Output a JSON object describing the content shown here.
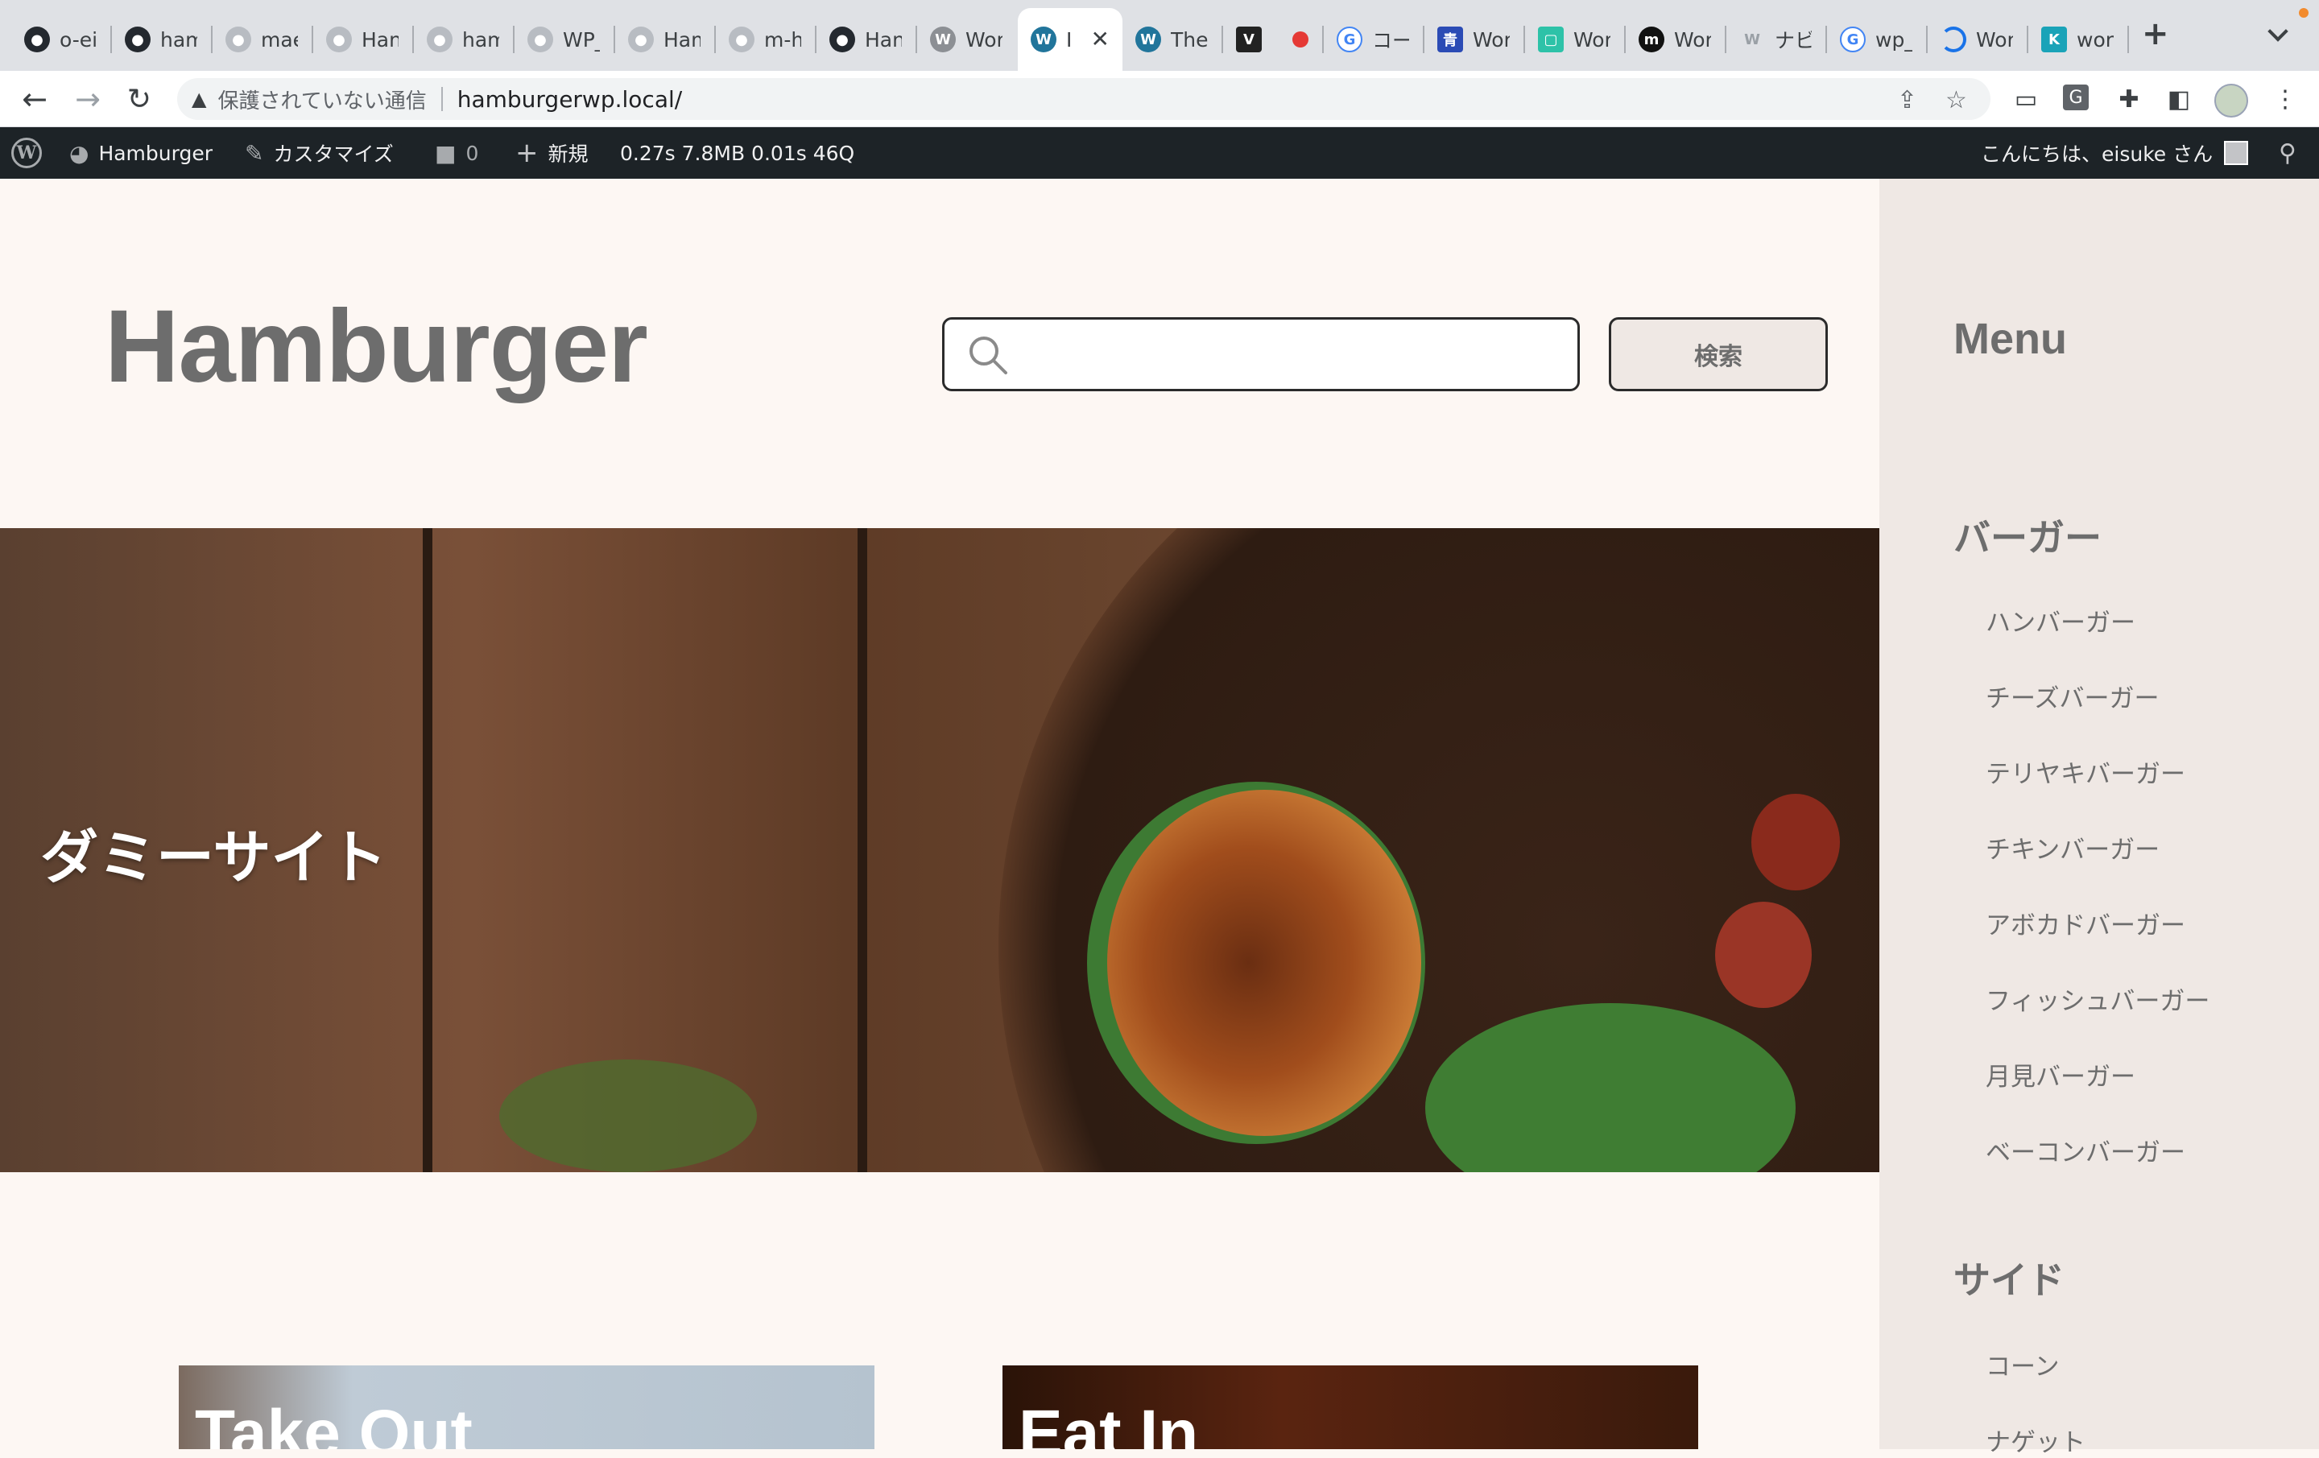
{
  "browser": {
    "tabs": [
      {
        "title": "o-ei",
        "icon": "github-icon"
      },
      {
        "title": "ham",
        "icon": "github-icon"
      },
      {
        "title": "mae",
        "icon": "github-icon"
      },
      {
        "title": "Han",
        "icon": "github-icon"
      },
      {
        "title": "ham",
        "icon": "github-icon"
      },
      {
        "title": "WP_",
        "icon": "github-icon"
      },
      {
        "title": "Ham",
        "icon": "github-icon"
      },
      {
        "title": "m-h",
        "icon": "github-icon"
      },
      {
        "title": "Han",
        "icon": "github-icon"
      },
      {
        "title": "Wor",
        "icon": "wordpress-icon"
      },
      {
        "title": "I",
        "icon": "wordpress-icon"
      },
      {
        "title": "The",
        "icon": "wordpress-icon"
      },
      {
        "title": "",
        "icon": "v-icon"
      },
      {
        "title": "コー",
        "icon": "google-icon"
      },
      {
        "title": "Wor",
        "icon": "ao-icon"
      },
      {
        "title": "Wor",
        "icon": "notebook-icon"
      },
      {
        "title": "Wor",
        "icon": "m-icon"
      },
      {
        "title": "ナビ",
        "icon": "w-icon"
      },
      {
        "title": "wp_",
        "icon": "google-icon"
      },
      {
        "title": "Wor",
        "icon": "loading-icon"
      },
      {
        "title": "wor",
        "icon": "k-icon"
      }
    ],
    "new_tab_label": "+",
    "insecure_label": "保護されていない通信",
    "url": "hamburgerwp.local/"
  },
  "adminbar": {
    "site_name": "Hamburger",
    "customize": "カスタマイズ",
    "comments_count": "0",
    "new_label": "新規",
    "stats": "0.27s  7.8MB  0.01s  46Q",
    "greeting": "こんにちは、eisuke さん"
  },
  "page": {
    "site_title": "Hamburger",
    "search_button": "検索",
    "search_placeholder": "",
    "hero_text": "ダミーサイト",
    "cards": [
      {
        "title": "Take Out"
      },
      {
        "title": "Eat In"
      }
    ]
  },
  "sidebar": {
    "title": "Menu",
    "sections": [
      {
        "title": "バーガー",
        "items": [
          "ハンバーガー",
          "チーズバーガー",
          "テリヤキバーガー",
          "チキンバーガー",
          "アボカドバーガー",
          "フィッシュバーガー",
          "月見バーガー",
          "ベーコンバーガー"
        ]
      },
      {
        "title": "サイド",
        "items": [
          "コーン",
          "ナゲット"
        ]
      }
    ]
  },
  "colors": {
    "page_bg": "#fdf7f3",
    "sidebar_bg": "#efe8e4",
    "text_gray": "#6d6d6d",
    "adminbar_bg": "#1d2327"
  }
}
